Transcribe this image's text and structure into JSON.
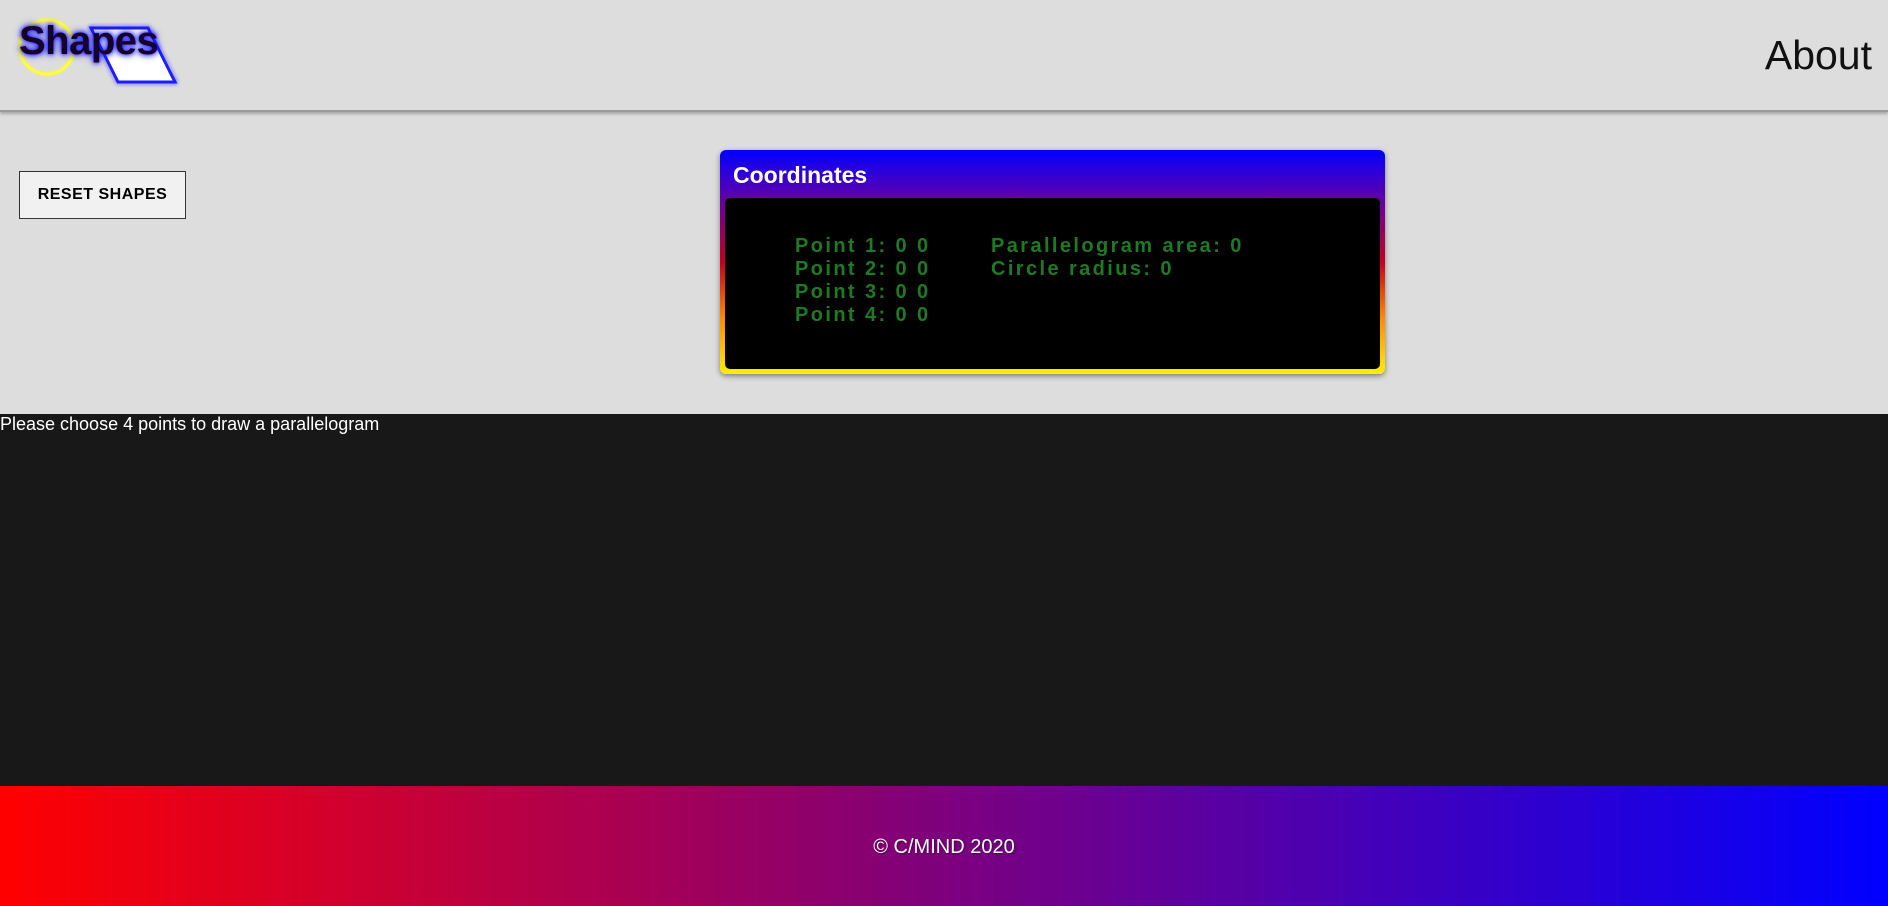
{
  "header": {
    "logo_text": "Shapes",
    "about_label": "About"
  },
  "controls": {
    "reset_label": "RESET SHAPES"
  },
  "coordinates_panel": {
    "title": "Coordinates",
    "points": [
      {
        "label": "Point 1:",
        "x": "0",
        "y": "0"
      },
      {
        "label": "Point 2:",
        "x": "0",
        "y": "0"
      },
      {
        "label": "Point 3:",
        "x": "0",
        "y": "0"
      },
      {
        "label": "Point 4:",
        "x": "0",
        "y": "0"
      }
    ],
    "point_lines": [
      "Point 1: 0 0",
      "Point 2: 0 0",
      "Point 3: 0 0",
      "Point 4: 0 0"
    ],
    "parallelogram_area": "Parallelogram area: 0",
    "circle_radius": "Circle radius: 0"
  },
  "canvas": {
    "instruction": "Please choose 4 points to draw a parallelogram"
  },
  "footer": {
    "copyright": "© C/MIND 2020"
  },
  "colors": {
    "header_bg": "#dddddd",
    "canvas_bg": "#181818",
    "coord_text": "#1f7a24",
    "logo_circle": "#ffff33",
    "logo_parallelogram": "#1a1aff",
    "footer_gradient_start": "#ff0000",
    "footer_gradient_end": "#0000ff"
  }
}
